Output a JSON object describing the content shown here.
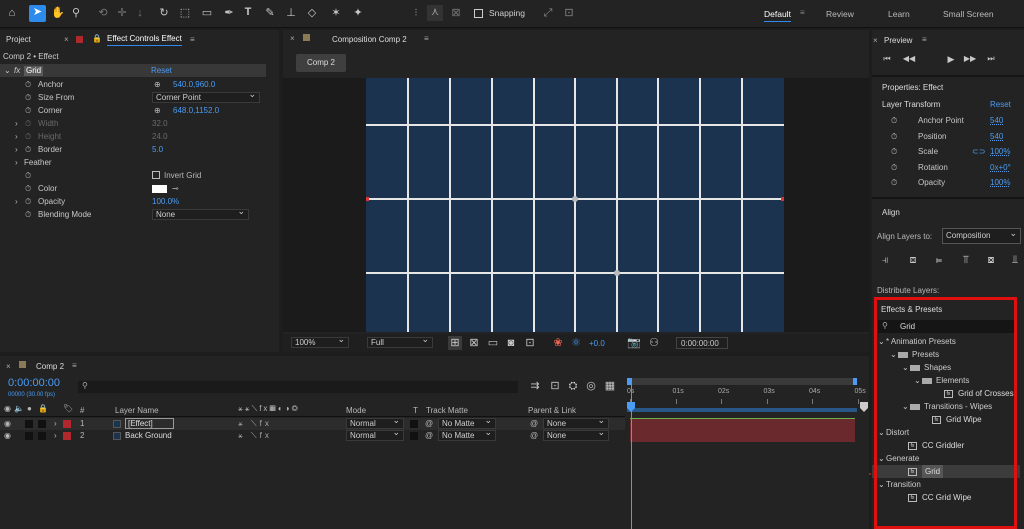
{
  "toolbar": {
    "snapping": "Snapping",
    "workspaces": [
      "Default",
      "Review",
      "Learn",
      "Small Screen"
    ]
  },
  "project": {
    "tab_project": "Project",
    "tab_effects": "Effect Controls Effect",
    "subtitle": "Comp 2 • Effect",
    "effect": "Grid",
    "reset": "Reset",
    "props": [
      {
        "name": "Anchor",
        "value": "540.0,960.0",
        "blue": true
      },
      {
        "name": "Size From",
        "value": "Corner Point",
        "dd": true
      },
      {
        "name": "Corner",
        "value": "648.0,1152.0",
        "blue": true
      },
      {
        "name": "Width",
        "value": "32.0",
        "dim": true
      },
      {
        "name": "Height",
        "value": "24.0",
        "dim": true
      },
      {
        "name": "Border",
        "value": "5.0",
        "blue": true
      },
      {
        "name": "Feather",
        "value": ""
      },
      {
        "name": "",
        "value": "Invert Grid",
        "cb": true
      },
      {
        "name": "Color",
        "value": "",
        "color": true
      },
      {
        "name": "Opacity",
        "value": "100.0%",
        "blue": true
      },
      {
        "name": "Blending Mode",
        "value": "None",
        "dd": true
      }
    ]
  },
  "comp": {
    "tab": "Composition Comp 2",
    "button": "Comp 2",
    "zoom": "100%",
    "quality": "Full",
    "exposure": "+0.0",
    "time": "0:00:00:00"
  },
  "preview": {
    "title": "Preview"
  },
  "properties": {
    "title": "Properties: Effect",
    "section": "Layer Transform",
    "reset": "Reset",
    "items": [
      {
        "name": "Anchor Point",
        "value": "540"
      },
      {
        "name": "Position",
        "value": "540"
      },
      {
        "name": "Scale",
        "value": "100%"
      },
      {
        "name": "Rotation",
        "value": "0x+0°"
      },
      {
        "name": "Opacity",
        "value": "100%"
      }
    ]
  },
  "align": {
    "title": "Align",
    "align_to_label": "Align Layers to:",
    "align_to": "Composition",
    "distribute": "Distribute Layers:"
  },
  "effects": {
    "title": "Effects & Presets",
    "search": "Grid",
    "tree": [
      {
        "label": "* Animation Presets",
        "depth": 0,
        "kind": "cat"
      },
      {
        "label": "Presets",
        "depth": 1,
        "kind": "folder"
      },
      {
        "label": "Shapes",
        "depth": 2,
        "kind": "folder"
      },
      {
        "label": "Elements",
        "depth": 3,
        "kind": "folder"
      },
      {
        "label": "Grid of Crosses",
        "depth": 4,
        "kind": "preset"
      },
      {
        "label": "Transitions - Wipes",
        "depth": 2,
        "kind": "folder"
      },
      {
        "label": "Grid Wipe",
        "depth": 3,
        "kind": "preset"
      },
      {
        "label": "Distort",
        "depth": 0,
        "kind": "cat"
      },
      {
        "label": "CC Griddler",
        "depth": 1,
        "kind": "fx"
      },
      {
        "label": "Generate",
        "depth": 0,
        "kind": "cat"
      },
      {
        "label": "Grid",
        "depth": 1,
        "kind": "fx",
        "selected": true
      },
      {
        "label": "Transition",
        "depth": 0,
        "kind": "cat"
      },
      {
        "label": "CC Grid Wipe",
        "depth": 1,
        "kind": "fx"
      }
    ]
  },
  "timeline": {
    "tab": "Comp 2",
    "timecode": "0:00:00:00",
    "fps": "00000 (30.00 fps)",
    "cols": {
      "num": "#",
      "layer": "Layer Name",
      "mode": "Mode",
      "t": "T",
      "matte": "Track Matte",
      "parent": "Parent & Link"
    },
    "ruler": [
      "0s",
      "01s",
      "02s",
      "03s",
      "04s",
      "05s"
    ],
    "layers": [
      {
        "num": "1",
        "name": "[Effect]",
        "mode": "Normal",
        "matte": "No Matte",
        "parent": "None"
      },
      {
        "num": "2",
        "name": "Back Ground",
        "mode": "Normal",
        "matte": "No Matte",
        "parent": "None"
      }
    ]
  },
  "colors": {
    "accent": "#2d8ceb",
    "grid_bg": "#1c3350",
    "annot": "#e01010"
  }
}
